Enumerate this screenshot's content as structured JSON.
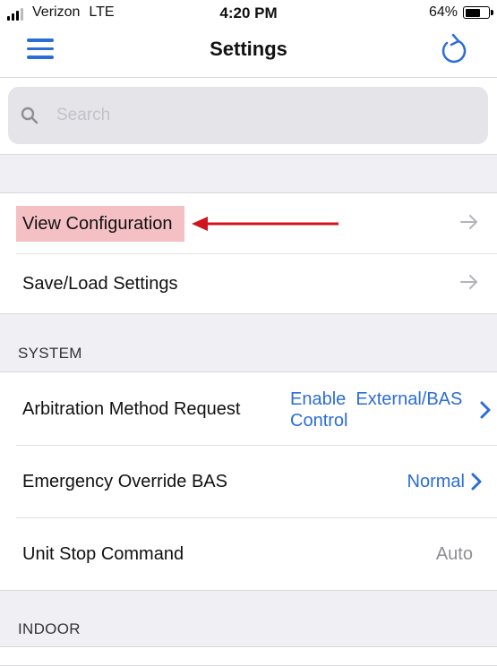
{
  "status_bar": {
    "carrier": "Verizon",
    "network": "LTE",
    "time": "4:20 PM",
    "battery_percent": "64%",
    "battery_level": 0.64
  },
  "nav": {
    "title": "Settings"
  },
  "search": {
    "placeholder": "Search",
    "value": ""
  },
  "top_group": {
    "items": [
      {
        "label": "View Configuration"
      },
      {
        "label": "Save/Load Settings"
      }
    ]
  },
  "system": {
    "header": "SYSTEM",
    "items": [
      {
        "label": "Arbitration Method Request",
        "value_line1": "Enable  External/BAS",
        "value_line2": "Control"
      },
      {
        "label": "Emergency Override BAS",
        "value": "Normal"
      },
      {
        "label": "Unit Stop Command",
        "value": "Auto"
      }
    ]
  },
  "indoor": {
    "header": "INDOOR"
  },
  "colors": {
    "accent": "#2b6dd6",
    "highlight": "#f4c0c4",
    "annotation_arrow": "#d0141e"
  }
}
